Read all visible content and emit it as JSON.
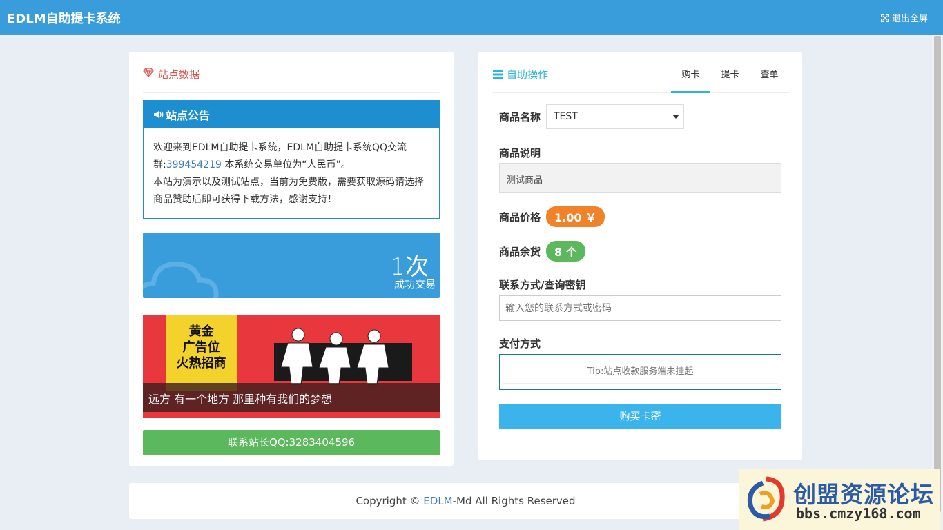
{
  "app": {
    "title": "EDLM自助提卡系统",
    "fullscreen_label": "退出全屏"
  },
  "left": {
    "section_title": "站点数据",
    "notice": {
      "title": "站点公告",
      "line1": "欢迎来到EDLM自助提卡系统，EDLM自助提卡系统QQ交流群:",
      "qq_group": "399454219",
      "line1_end": " 本系统交易单位为“人民币”。",
      "line2": "本站为演示以及测试站点，当前为免费版，需要获取源码请选择商品赞助后即可获得下载方法，感谢支持！"
    },
    "stat": {
      "value": "1次",
      "label": "成功交易"
    },
    "banner": {
      "ad_line1": "黄金",
      "ad_line2": "广告位",
      "ad_line3": "火热招商",
      "caption": "远方 有一个地方 那里种有我们的梦想"
    },
    "contact_button": "联系站长QQ:3283404596"
  },
  "right": {
    "section_title": "自助操作",
    "tabs": [
      "购卡",
      "提卡",
      "查单"
    ],
    "active_tab": 0,
    "product_name_label": "商品名称",
    "product_selected": "TEST",
    "product_desc_label": "商品说明",
    "product_desc": "测试商品",
    "price_label": "商品价格",
    "price_value": "1.00 ￥",
    "stock_label": "商品余货",
    "stock_value": "8 个",
    "contact_label": "联系方式/查询密钥",
    "contact_placeholder": "输入您的联系方式或密码",
    "pay_label": "支付方式",
    "pay_tip": "Tip:站点收款服务端未挂起",
    "buy_button": "购买卡密"
  },
  "footer": {
    "prefix": "Copyright © ",
    "brand": "EDLM",
    "suffix": "-Md All Rights Reserved"
  },
  "watermark": {
    "title": "创盟资源论坛",
    "url": "bbs.cmzy168.com"
  },
  "colors": {
    "header": "#3a9ddb",
    "accent": "#2bb6d6",
    "price": "#f0822a",
    "stock": "#5cb85c",
    "buy": "#3bb4ec"
  },
  "icons": [
    "diamond-icon",
    "speaker-icon",
    "cloud-icon",
    "server-icon",
    "expand-icon"
  ]
}
